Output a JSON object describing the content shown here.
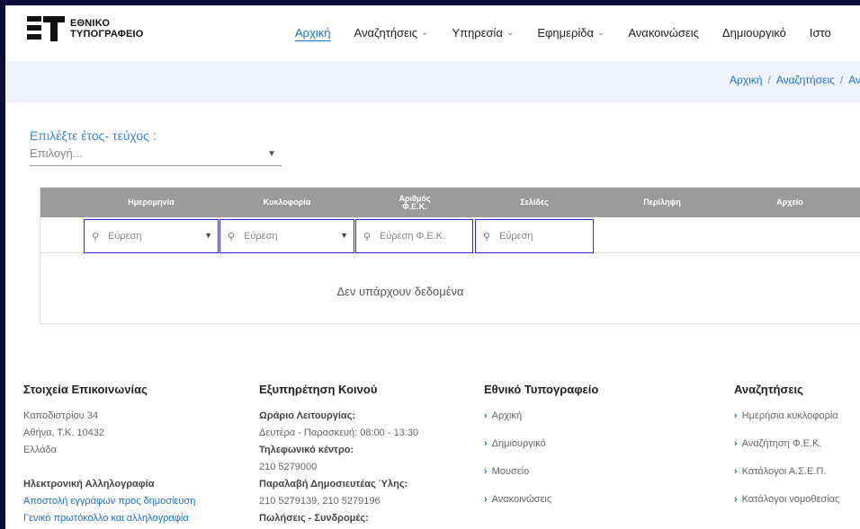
{
  "header": {
    "logo_line1": "ΕΘΝΙΚΟ",
    "logo_line2": "ΤΥΠΟΓΡΑΦΕΙΟ",
    "nav": [
      {
        "label": "Αρχική",
        "active": true,
        "dropdown": false
      },
      {
        "label": "Αναζητήσεις",
        "active": false,
        "dropdown": true
      },
      {
        "label": "Υπηρεσία",
        "active": false,
        "dropdown": true
      },
      {
        "label": "Εφημερίδα",
        "active": false,
        "dropdown": true
      },
      {
        "label": "Ανακοινώσεις",
        "active": false,
        "dropdown": false
      },
      {
        "label": "Δημιουργικό",
        "active": false,
        "dropdown": false
      },
      {
        "label": "Ιστο",
        "active": false,
        "dropdown": false
      }
    ]
  },
  "breadcrumb": {
    "items": [
      "Αρχική",
      "Αναζητήσεις",
      "Ανα"
    ]
  },
  "selector": {
    "label": "Επιλέξτε έτος- τεύχος :",
    "value": "Επιλογή..."
  },
  "table": {
    "columns": [
      "Ημερομηνία",
      "Κυκλοφορία",
      "Αριθμός Φ.Ε.Κ.",
      "Σελίδες",
      "Περίληψη",
      "Αρχείο"
    ],
    "filters": [
      {
        "placeholder": "Εύρεση",
        "dropdown": true
      },
      {
        "placeholder": "Εύρεση",
        "dropdown": true
      },
      {
        "placeholder": "Εύρεση Φ.Ε.Κ.",
        "dropdown": false
      },
      {
        "placeholder": "Εύρεση",
        "dropdown": false
      }
    ],
    "empty_message": "Δεν υπάρχουν δεδομένα"
  },
  "footer": {
    "contact": {
      "title": "Στοιχεία Επικοινωνίας",
      "address": [
        "Καποδιστρίου 34",
        "Αθήνα, Τ.Κ. 10432",
        "Ελλάδα"
      ],
      "email_title": "Ηλεκτρονική Αλληλογραφία",
      "email_links": [
        "Αποστολή εγγράφων προς δημοσίευση",
        "Γενικό πρωτόκολλο και αλληλογραφία"
      ]
    },
    "service": {
      "title": "Εξυπηρέτηση Κοινού",
      "hours_label": "Ωράριο Λειτουργίας:",
      "hours_value": "Δευτέρα - Παρασκευή: 08:00 - 13:30",
      "phone_label": "Τηλεφωνικό κέντρο:",
      "phone_value": "210 5279000",
      "receive_label": "Παραλαβή Δημοσιευτέας Ύλης:",
      "receive_value": "210 5279139, 210 5279196",
      "sales_label": "Πωλήσεις - Συνδρομές:"
    },
    "printing": {
      "title": "Εθνικό Τυπογραφείο",
      "links": [
        "Αρχική",
        "Δημιουργικό",
        "Μουσείο",
        "Ανακοινώσεις"
      ]
    },
    "searches": {
      "title": "Αναζητήσεις",
      "links": [
        "Ημερήσια κυκλοφορία",
        "Αναζήτηση Φ.Ε.Κ.",
        "Κατάλογοι Α.Σ.Ε.Π.",
        "Κατάλογοι νομοθεσίας"
      ]
    }
  }
}
